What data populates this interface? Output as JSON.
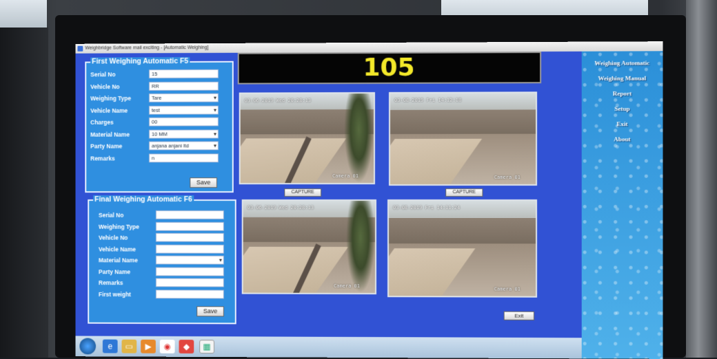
{
  "window": {
    "title": "Weighbridge Software mail exciting - [Automatic Weighing]"
  },
  "display": {
    "weight": "105"
  },
  "first_panel": {
    "legend": "First Weighing Automatic F5",
    "fields": [
      {
        "label": "Serial No",
        "value": "15",
        "dropdown": false
      },
      {
        "label": "Vehicle No",
        "value": "RR",
        "dropdown": false
      },
      {
        "label": "Weighing Type",
        "value": "Tare",
        "dropdown": true
      },
      {
        "label": "Vehicle Name",
        "value": "test",
        "dropdown": true
      },
      {
        "label": "Charges",
        "value": "00",
        "dropdown": false
      },
      {
        "label": "Material Name",
        "value": "10 MM",
        "dropdown": true
      },
      {
        "label": "Party Name",
        "value": "anjana anjani ltd",
        "dropdown": true
      },
      {
        "label": "Remarks",
        "value": "n",
        "dropdown": false
      }
    ],
    "save_label": "Save"
  },
  "final_panel": {
    "legend": "Final Weighing Automatic F6",
    "fields": [
      {
        "label": "Serial No",
        "value": "",
        "dropdown": false
      },
      {
        "label": "Weighing Type",
        "value": "",
        "dropdown": false
      },
      {
        "label": "Vehicle No",
        "value": "",
        "dropdown": false
      },
      {
        "label": "Vehicle Name",
        "value": "",
        "dropdown": false
      },
      {
        "label": "Material Name",
        "value": "",
        "dropdown": true
      },
      {
        "label": "Party Name",
        "value": "",
        "dropdown": false
      },
      {
        "label": "Remarks",
        "value": "",
        "dropdown": false
      },
      {
        "label": "First weight",
        "value": "",
        "dropdown": false
      }
    ],
    "save_label": "Save"
  },
  "cameras": [
    {
      "timestamp": "03-06-2019 Wed 20:28:13",
      "label": "Camera 01"
    },
    {
      "timestamp": "03-08-2019 Fri 14:12:18",
      "label": "Camera 01"
    },
    {
      "timestamp": "03-06-2019 Wed 20:28:13",
      "label": "Camera 01"
    },
    {
      "timestamp": "03-08-2019 Fri 14:11:24",
      "label": "Camera 01"
    }
  ],
  "capture_buttons": [
    "CAPTURE",
    "CAPTURE"
  ],
  "exit_button": "Exit",
  "sidebar": {
    "items": [
      "Weighing Automatic",
      "Weighing Manual",
      "Report",
      "Setup",
      "Exit",
      "About"
    ]
  },
  "taskbar": {
    "icons": [
      "windows-start-icon",
      "ie-icon",
      "folder-icon",
      "media-player-icon",
      "chrome-icon",
      "anydesk-icon",
      "app-window-icon"
    ]
  }
}
